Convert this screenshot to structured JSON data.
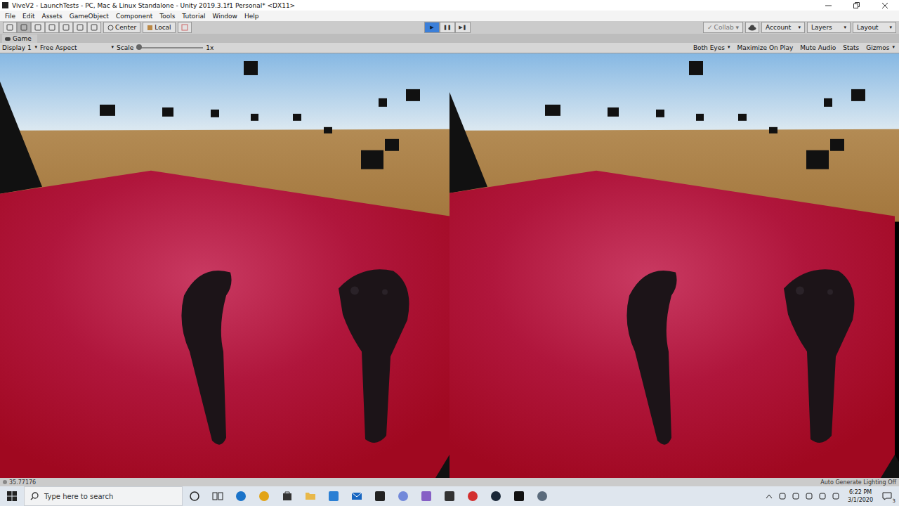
{
  "window": {
    "title": "ViveV2 - LaunchTests - PC, Mac & Linux Standalone - Unity 2019.3.1f1 Personal* <DX11>"
  },
  "menu": [
    "File",
    "Edit",
    "Assets",
    "GameObject",
    "Component",
    "Tools",
    "Tutorial",
    "Window",
    "Help"
  ],
  "toolbar": {
    "pivot": "Center",
    "space": "Local",
    "playback": [
      {
        "icon": "▶",
        "selected": true
      },
      {
        "icon": "❚❚",
        "selected": false
      },
      {
        "icon": "▶❚",
        "selected": false
      }
    ],
    "collab": {
      "label": "Collab",
      "checked": true,
      "disabled": true
    },
    "dropdowns": [
      "Account",
      "Layers",
      "Layout"
    ]
  },
  "game": {
    "tab": "Game",
    "display": "Display 1",
    "aspect": "Free Aspect",
    "scale_label": "Scale",
    "scale_value": "1x",
    "scale_level": 0.0,
    "view_mode": "Both Eyes",
    "toggles": [
      {
        "label": "Maximize On Play",
        "on": false
      },
      {
        "label": "Mute Audio",
        "on": false
      },
      {
        "label": "Stats",
        "on": false
      }
    ],
    "gizmos": "Gizmos"
  },
  "status_bar": {
    "message": "35.77176",
    "lighting": "Auto Generate Lighting Off"
  },
  "taskbar": {
    "search_placeholder": "Type here to search",
    "time": "6:22 PM",
    "date": "3/1/2020",
    "notifications": "3"
  }
}
